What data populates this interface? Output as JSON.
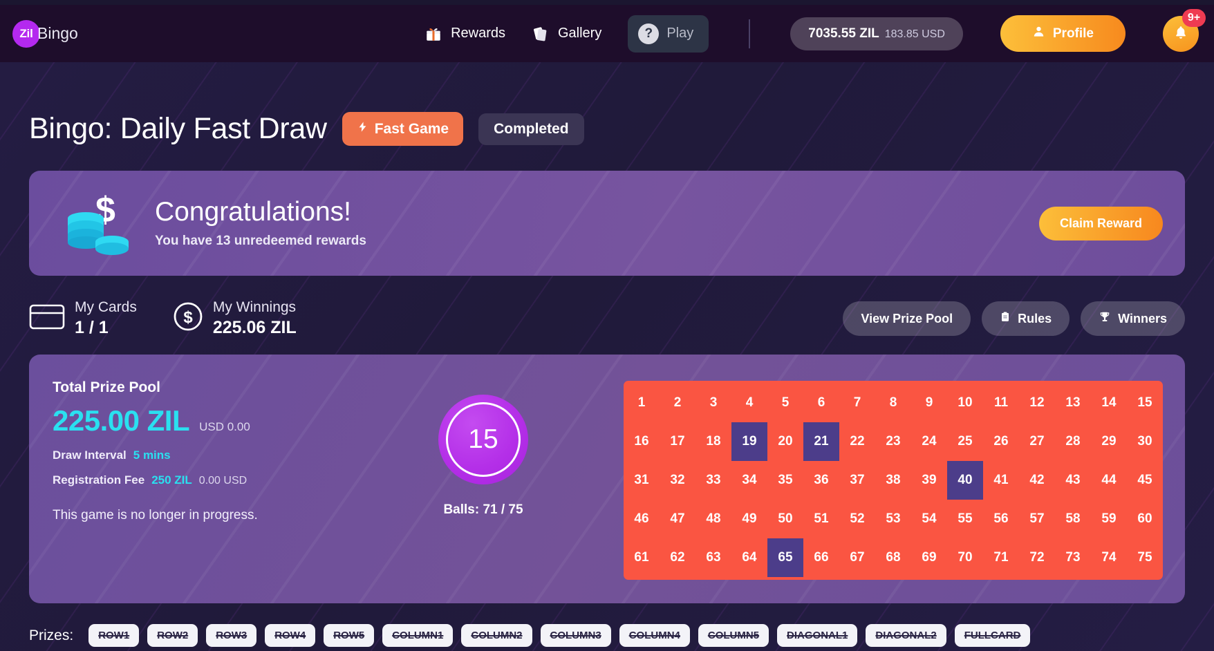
{
  "header": {
    "brand_badge": "Zil",
    "brand_name": "Bingo",
    "nav": [
      {
        "label": "Rewards",
        "icon": "gift-icon"
      },
      {
        "label": "Gallery",
        "icon": "cards-icon"
      }
    ],
    "play_label": "Play",
    "play_icon": "question-mark-icon",
    "balance_zil": "7035.55 ZIL",
    "balance_usd": "183.85 USD",
    "profile_label": "Profile",
    "profile_icon": "user-icon",
    "bell_icon": "bell-icon",
    "bell_badge": "9+"
  },
  "title": {
    "text": "Bingo: Daily Fast Draw",
    "fast_badge": "Fast Game",
    "fast_badge_icon": "lightning-bolt-icon",
    "status_badge": "Completed"
  },
  "congrats": {
    "icon": "coins-dollar-icon",
    "title": "Congratulations!",
    "subtitle": "You have 13 unredeemed rewards",
    "claim_label": "Claim Reward"
  },
  "stats": {
    "cards_icon": "card-icon",
    "cards_label": "My Cards",
    "cards_value": "1 / 1",
    "winnings_icon": "dollar-circle-icon",
    "winnings_label": "My Winnings",
    "winnings_value": "225.06 ZIL",
    "actions": [
      {
        "label": "View Prize Pool",
        "icon": ""
      },
      {
        "label": "Rules",
        "icon": "clipboard-icon"
      },
      {
        "label": "Winners",
        "icon": "trophy-icon"
      }
    ]
  },
  "game": {
    "pool_label": "Total Prize Pool",
    "pool_amount": "225.00 ZIL",
    "pool_usd": "USD 0.00",
    "draw_interval_label": "Draw Interval",
    "draw_interval_value": "5 mins",
    "registration_fee_label": "Registration Fee",
    "registration_fee_value": "250 ZIL",
    "registration_fee_usd": "0.00 USD",
    "progress_note": "This game is no longer in progress.",
    "current_ball": "15",
    "balls_count": "Balls: 71 / 75",
    "grid_total": 75,
    "grid_columns": 15,
    "unmarked_numbers": [
      19,
      21,
      40,
      65
    ]
  },
  "prizes": {
    "label": "Prizes:",
    "items": [
      "ROW1",
      "ROW2",
      "ROW3",
      "ROW4",
      "ROW5",
      "COLUMN1",
      "COLUMN2",
      "COLUMN3",
      "COLUMN4",
      "COLUMN5",
      "DIAGONAL1",
      "DIAGONAL2",
      "FULLCARD"
    ]
  },
  "colors": {
    "brand_purple": "#b429ef",
    "accent_orange": "#f7931e",
    "accent_cyan": "#2ae0f0",
    "grid_red": "#fa5542",
    "grid_marked": "#4c3d8a",
    "panel_purple": "#6e4f9c",
    "page_bg": "#211a3d",
    "header_bg": "#1e0d2b",
    "badge_red": "#ef3b52"
  }
}
